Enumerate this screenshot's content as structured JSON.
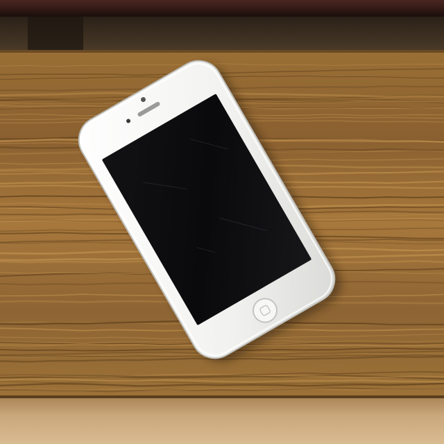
{
  "scene": {
    "subject": "white-smartphone",
    "surface": "wooden-plank",
    "colors": {
      "wood_base": "#8a6230",
      "wood_light": "#b78a4a",
      "wood_dark": "#5c3d1a",
      "top_rail": "#3a1e18",
      "bottom_area": "#c9a57a",
      "phone_body": "#f4f4f2",
      "phone_screen": "#0d0d0f"
    }
  }
}
